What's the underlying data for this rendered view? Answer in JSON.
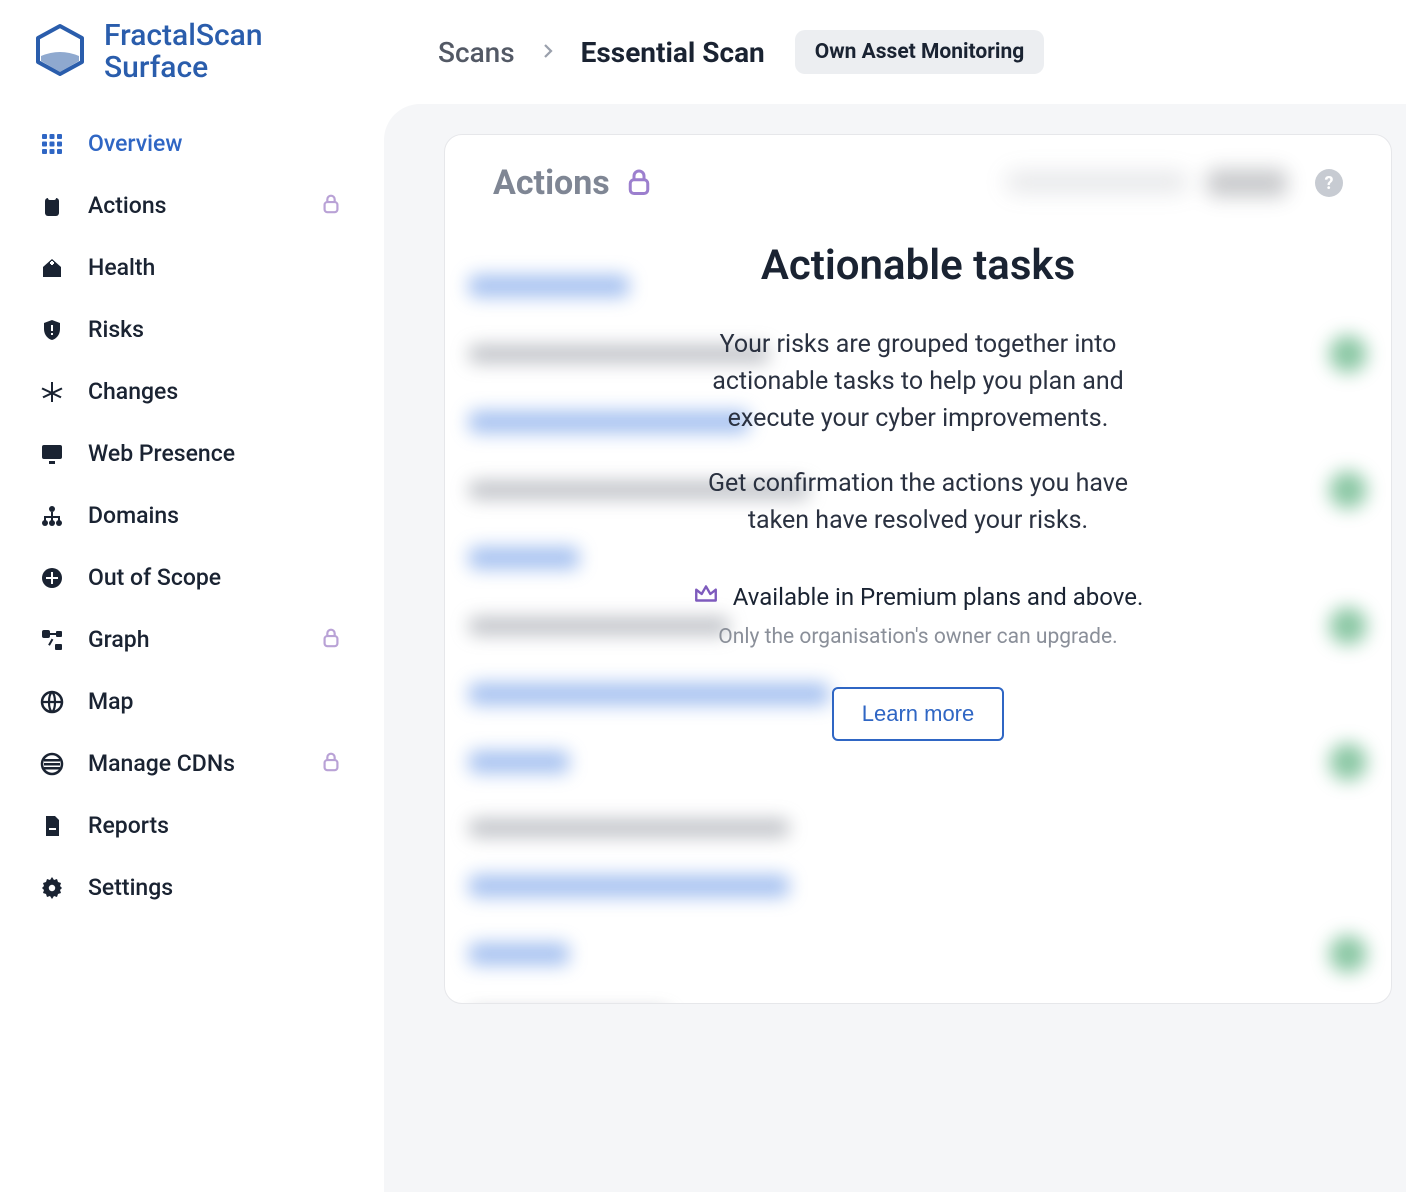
{
  "brand": {
    "line1": "FractalScan",
    "line2": "Surface"
  },
  "sidebar": {
    "items": [
      {
        "label": "Overview",
        "icon": "grid-icon",
        "locked": false,
        "active": true
      },
      {
        "label": "Actions",
        "icon": "clipboard-icon",
        "locked": true,
        "active": false
      },
      {
        "label": "Health",
        "icon": "house-plus-icon",
        "locked": false,
        "active": false
      },
      {
        "label": "Risks",
        "icon": "shield-alert-icon",
        "locked": false,
        "active": false
      },
      {
        "label": "Changes",
        "icon": "asterisk-icon",
        "locked": false,
        "active": false
      },
      {
        "label": "Web Presence",
        "icon": "monitor-icon",
        "locked": false,
        "active": false
      },
      {
        "label": "Domains",
        "icon": "sitemap-icon",
        "locked": false,
        "active": false
      },
      {
        "label": "Out of Scope",
        "icon": "plus-circle-icon",
        "locked": false,
        "active": false
      },
      {
        "label": "Graph",
        "icon": "graph-nodes-icon",
        "locked": true,
        "active": false
      },
      {
        "label": "Map",
        "icon": "globe-icon",
        "locked": false,
        "active": false
      },
      {
        "label": "Manage CDNs",
        "icon": "globe-bars-icon",
        "locked": true,
        "active": false
      },
      {
        "label": "Reports",
        "icon": "file-icon",
        "locked": false,
        "active": false
      },
      {
        "label": "Settings",
        "icon": "gear-icon",
        "locked": false,
        "active": false
      }
    ]
  },
  "breadcrumb": {
    "root": "Scans",
    "current": "Essential Scan",
    "badge": "Own Asset Monitoring"
  },
  "card": {
    "title": "Actions",
    "help": "?"
  },
  "overlay": {
    "title": "Actionable tasks",
    "p1": "Your risks are grouped together into actionable tasks to help you plan and execute your cyber improvements.",
    "p2": "Get confirmation the actions you have taken have resolved your risks.",
    "premium": "Available in Premium plans and above.",
    "owner_note": "Only the organisation's owner can upgrade.",
    "learn_more": "Learn more"
  }
}
